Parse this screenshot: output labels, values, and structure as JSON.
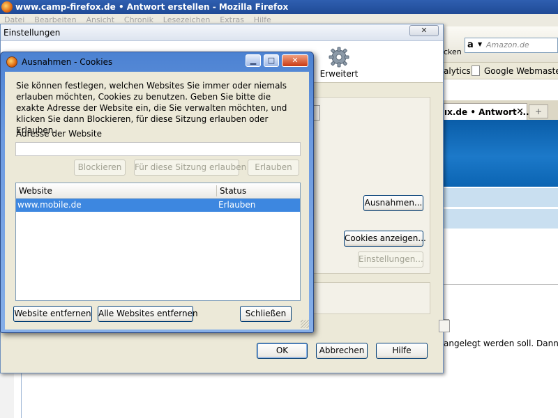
{
  "firefox": {
    "title": "www.camp-firefox.de • Antwort erstellen - Mozilla Firefox",
    "menu": [
      "Datei",
      "Bearbeiten",
      "Ansicht",
      "Chronik",
      "Lesezeichen",
      "Extras",
      "Hilfe"
    ],
    "toolbar_text": "cken",
    "search_placeholder": "Amazon.de",
    "bookmarks": [
      "alytics",
      "Google Webmaste"
    ],
    "tab_active": "ıx.de • Antwort ...",
    "tab_new_symbol": "+",
    "page_text": "angelegt werden soll. Dann k"
  },
  "settings": {
    "title": "Einstellungen",
    "pane_erweitert": "Erweitert",
    "buttons": {
      "ausnahmen": "Ausnahmen...",
      "cookies_anzeigen": "Cookies anzeigen...",
      "einstellungen": "Einstellungen...",
      "ok": "OK",
      "abbrechen": "Abbrechen",
      "hilfe": "Hilfe"
    }
  },
  "dialog": {
    "title": "Ausnahmen - Cookies",
    "description": "Sie können festlegen, welchen Websites Sie immer oder niemals erlauben möchten, Cookies zu benutzen. Geben Sie bitte die exakte Adresse der Website ein, die Sie verwalten möchten, und klicken Sie dann Blockieren, für diese Sitzung erlauben oder Erlauben.",
    "address_label": "Adresse der Website",
    "address_value": "",
    "buttons": {
      "blockieren": "Blockieren",
      "sitzung": "Für diese Sitzung erlauben",
      "erlauben": "Erlauben",
      "entfernen": "Website entfernen",
      "alle_entfernen": "Alle Websites entfernen",
      "schliessen": "Schließen"
    },
    "columns": [
      "Website",
      "Status"
    ],
    "rows": [
      {
        "website": "www.mobile.de",
        "status": "Erlauben"
      }
    ]
  },
  "colors": {
    "selection": "#3d87e0",
    "titlebar": "#2f5fb0",
    "dialog_frame": "#6c9ae0"
  }
}
